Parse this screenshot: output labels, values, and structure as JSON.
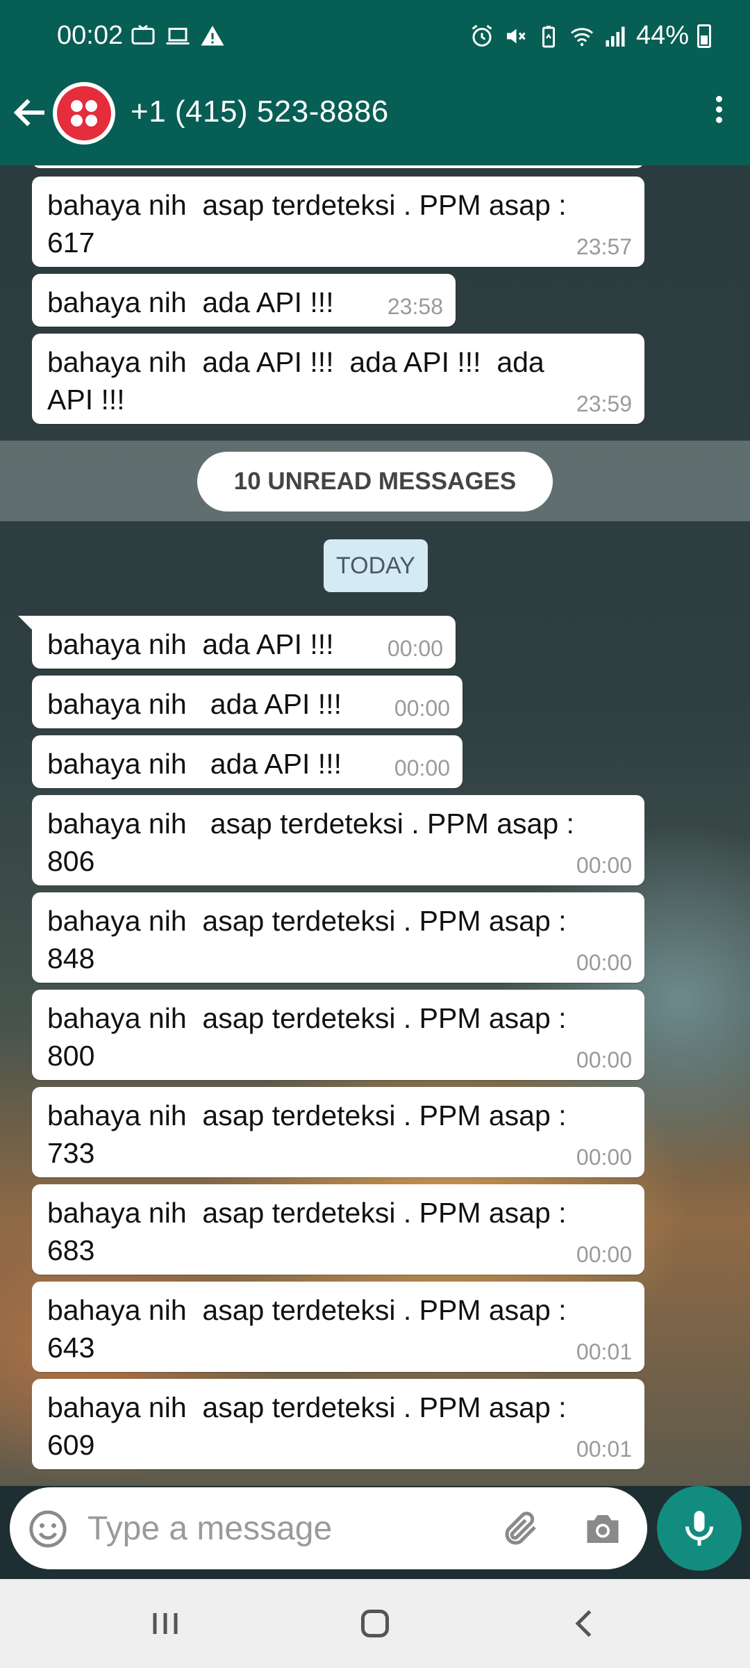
{
  "status_bar": {
    "time": "00:02",
    "battery": "44%",
    "left_icons": [
      "tv-icon",
      "laptop-icon",
      "warning-icon"
    ],
    "right_icons": [
      "alarm-icon",
      "mute-icon",
      "battery-saver-icon",
      "wifi-icon",
      "signal-icon",
      "battery-icon"
    ]
  },
  "header": {
    "contact": "+1 (415) 523-8886",
    "accent_color": "#075e54",
    "avatar_color": "#e52d3b"
  },
  "chat": {
    "unread_label": "10 UNREAD MESSAGES",
    "date_label": "TODAY",
    "messages": [
      {
        "text": "bahaya nih  asap terdeteksi . PPM asap :\n617",
        "time": "23:57"
      },
      {
        "text": "bahaya nih  ada API !!!",
        "time": "23:58"
      },
      {
        "text": "bahaya nih  ada API !!!  ada API !!!  ada\nAPI !!!",
        "time": "23:59"
      },
      {
        "text": "bahaya nih  ada API !!!",
        "time": "00:00"
      },
      {
        "text": "bahaya nih   ada API !!!",
        "time": "00:00"
      },
      {
        "text": "bahaya nih   ada API !!!",
        "time": "00:00"
      },
      {
        "text": "bahaya nih   asap terdeteksi . PPM asap :\n806",
        "time": "00:00"
      },
      {
        "text": "bahaya nih  asap terdeteksi . PPM asap :\n848",
        "time": "00:00"
      },
      {
        "text": "bahaya nih  asap terdeteksi . PPM asap :\n800",
        "time": "00:00"
      },
      {
        "text": "bahaya nih  asap terdeteksi . PPM asap :\n733",
        "time": "00:00"
      },
      {
        "text": "bahaya nih  asap terdeteksi . PPM asap :\n683",
        "time": "00:00"
      },
      {
        "text": "bahaya nih  asap terdeteksi . PPM asap :\n643",
        "time": "00:01"
      },
      {
        "text": "bahaya nih  asap terdeteksi . PPM asap :\n609",
        "time": "00:01"
      }
    ]
  },
  "input": {
    "placeholder": "Type a message"
  }
}
